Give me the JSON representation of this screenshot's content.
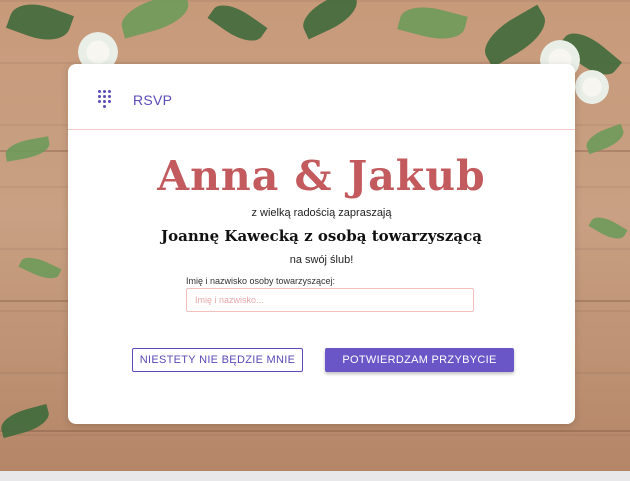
{
  "header": {
    "brand": "RSVP",
    "logo_icon": "dots-grid-icon"
  },
  "invitation": {
    "couple": "Anna & Jakub",
    "invite_line": "z wielką radością zapraszają",
    "guest": "Joannę Kawecką z osobą towarzyszącą",
    "occasion": "na swój ślub!"
  },
  "companion": {
    "label": "Imię i nazwisko osoby towarzyszącej:",
    "placeholder": "Imię i nazwisko...",
    "value": ""
  },
  "buttons": {
    "decline": "NIESTETY NIE BĘDZIE MNIE",
    "confirm": "POTWIERDZAM PRZYBYCIE"
  },
  "colors": {
    "accent": "#5b4bb6",
    "names": "#c25a5e",
    "field_border": "#f2c0bf"
  }
}
